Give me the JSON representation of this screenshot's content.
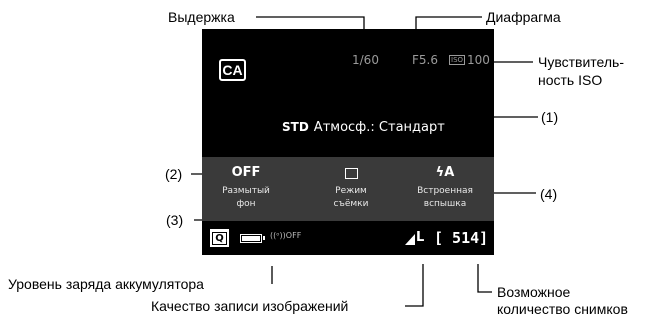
{
  "screen": {
    "mode_badge": "CA",
    "shutter_speed": "1/60",
    "aperture": "F5.6",
    "iso_icon": "ISO",
    "iso_value": "100",
    "ambience_icon": "STD",
    "ambience_text": "Атмосф.: Стандарт",
    "settings": [
      {
        "value": "OFF",
        "label_line1": "Размытый",
        "label_line2": "фон"
      },
      {
        "value": "",
        "label_line1": "Режим",
        "label_line2": "съёмки"
      },
      {
        "value": "ϟA",
        "label_line1": "Встроенная",
        "label_line2": "вспышка"
      }
    ],
    "quick_button": "Q",
    "battery_level": 1.0,
    "wifi_status": "((ᵒ))OFF",
    "image_quality": "L",
    "shots_remaining": "[ 514]"
  },
  "labels": {
    "shutter": "Выдержка",
    "aperture": "Диафрагма",
    "iso_line1": "Чувствитель-",
    "iso_line2": "ность ISO",
    "ref1": "(1)",
    "ref2": "(2)",
    "ref3": "(3)",
    "ref4": "(4)",
    "battery": "Уровень заряда аккумулятора",
    "quality": "Качество записи изображений",
    "shots_line1": "Возможное",
    "shots_line2": "количество снимков"
  }
}
